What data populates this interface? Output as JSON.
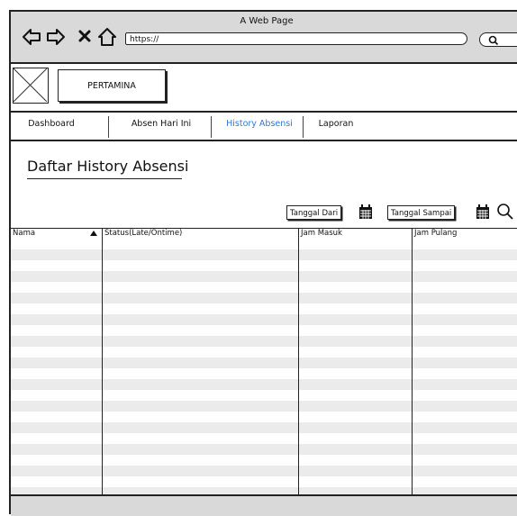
{
  "window": {
    "title": "A Web Page"
  },
  "address_bar": {
    "url": "https://"
  },
  "header": {
    "brand_label": "PERTAMINA"
  },
  "tabs": [
    {
      "label": "Dashboard",
      "active": false
    },
    {
      "label": "Absen Hari Ini",
      "active": false
    },
    {
      "label": "History Absensi",
      "active": true
    },
    {
      "label": "Laporan",
      "active": false
    }
  ],
  "page": {
    "title": "Daftar History Absensi"
  },
  "filters": {
    "from_label": "Tanggal Dari",
    "to_label": "Tanggal Sampai"
  },
  "table": {
    "columns": [
      "Nama",
      "Status(Late/Ontime)",
      "Jam Masuk",
      "Jam Pulang"
    ],
    "sort_column": "Nama",
    "rows": []
  },
  "colors": {
    "active_tab": "#2a7ad6",
    "chrome": "#d9d9d9",
    "row_stripe": "#ebebeb"
  },
  "icons": [
    "back-arrow-icon",
    "forward-arrow-icon",
    "close-icon",
    "home-icon",
    "search-icon",
    "calendar-icon",
    "magnifier-icon",
    "sort-up-icon",
    "image-placeholder-icon"
  ]
}
